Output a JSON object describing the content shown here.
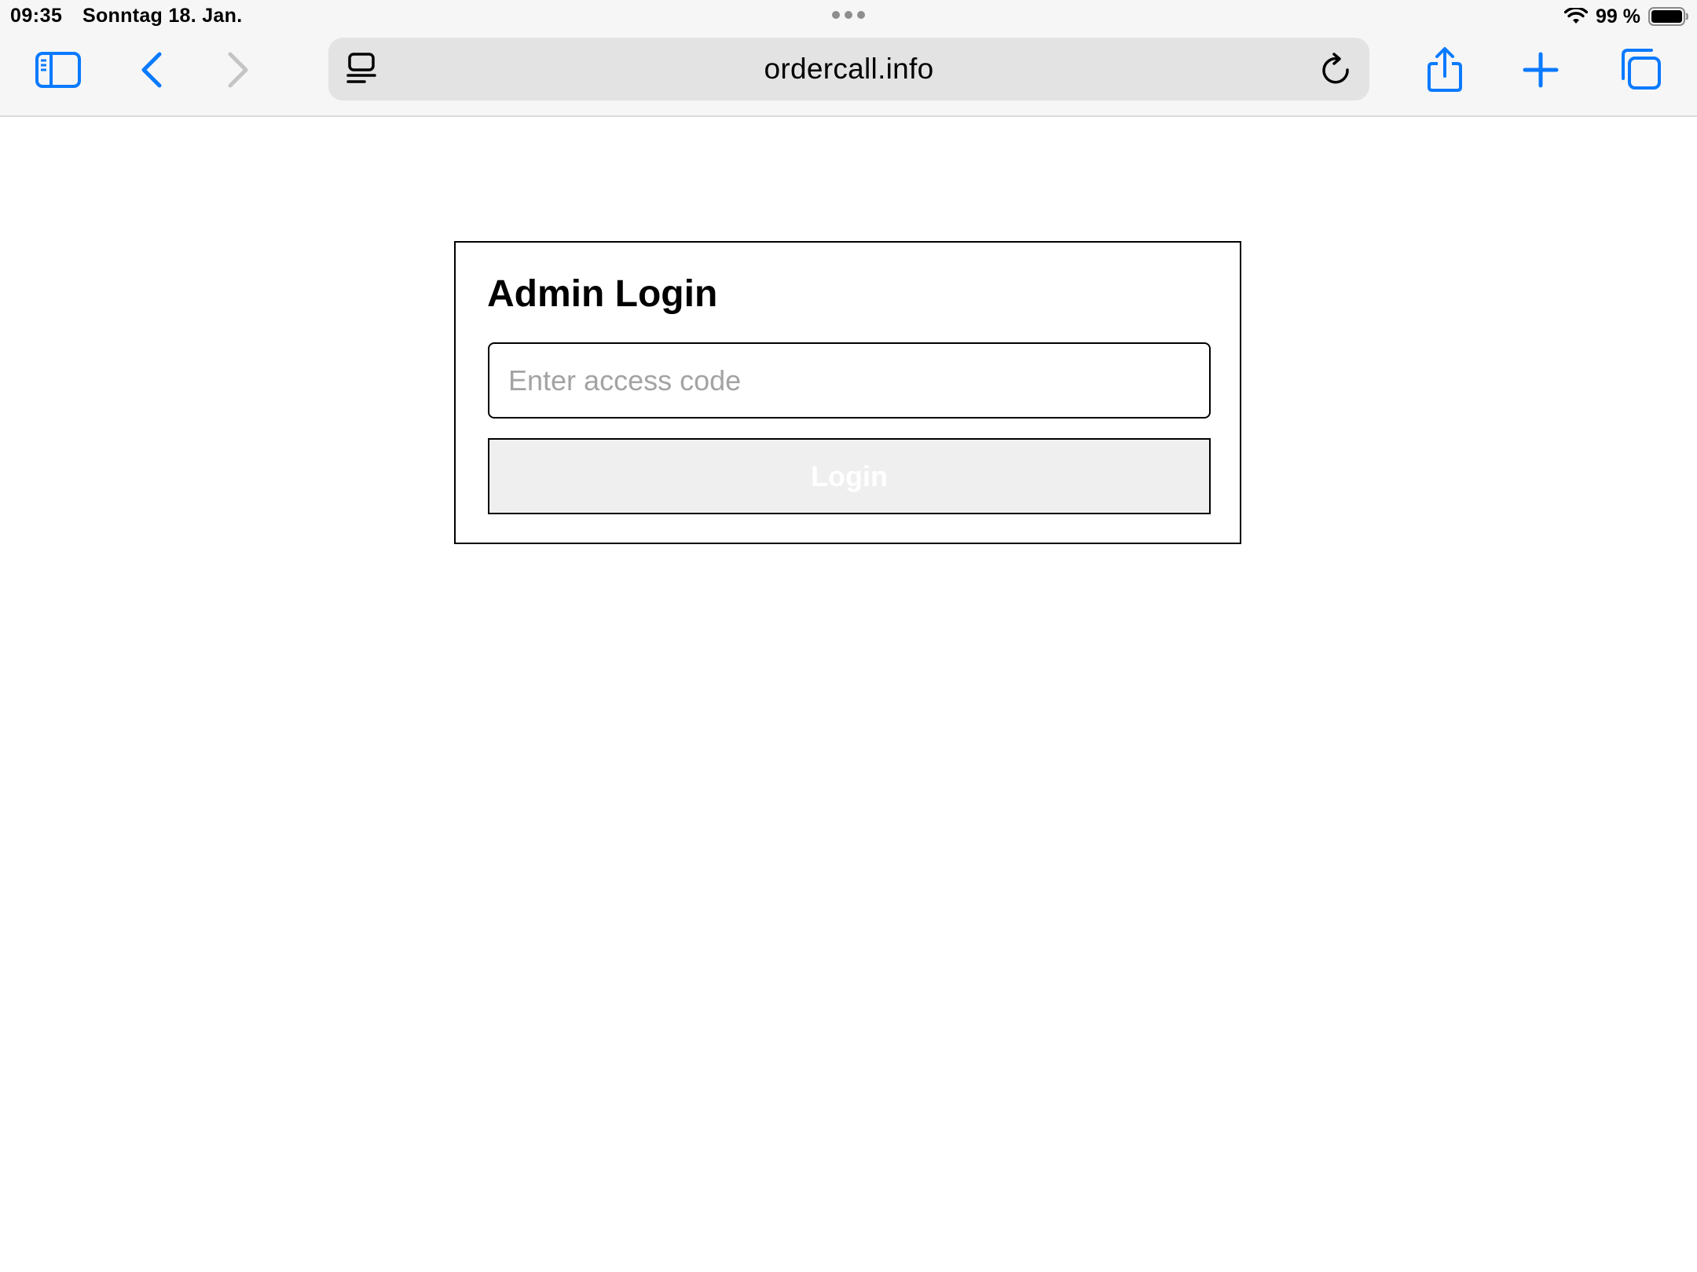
{
  "status_bar": {
    "time": "09:35",
    "date": "Sonntag 18. Jan.",
    "battery_percent": "99 %",
    "battery_level": 0.99,
    "wifi_icon": "wifi-icon",
    "battery_icon": "battery-icon"
  },
  "toolbar": {
    "url": "ordercall.info",
    "icons": {
      "sidebar": "sidebar-icon",
      "back": "chevron-left-icon",
      "forward": "chevron-right-icon",
      "reader": "page-menu-icon",
      "reload": "reload-icon",
      "share": "share-icon",
      "new_tab": "plus-icon",
      "tabs": "tabs-overview-icon"
    },
    "accent_color": "#0a7aff",
    "disabled_color": "#c4c4c4"
  },
  "login": {
    "title": "Admin Login",
    "code_placeholder": "Enter access code",
    "code_value": "",
    "button_label": "Login",
    "button_disabled": true
  }
}
